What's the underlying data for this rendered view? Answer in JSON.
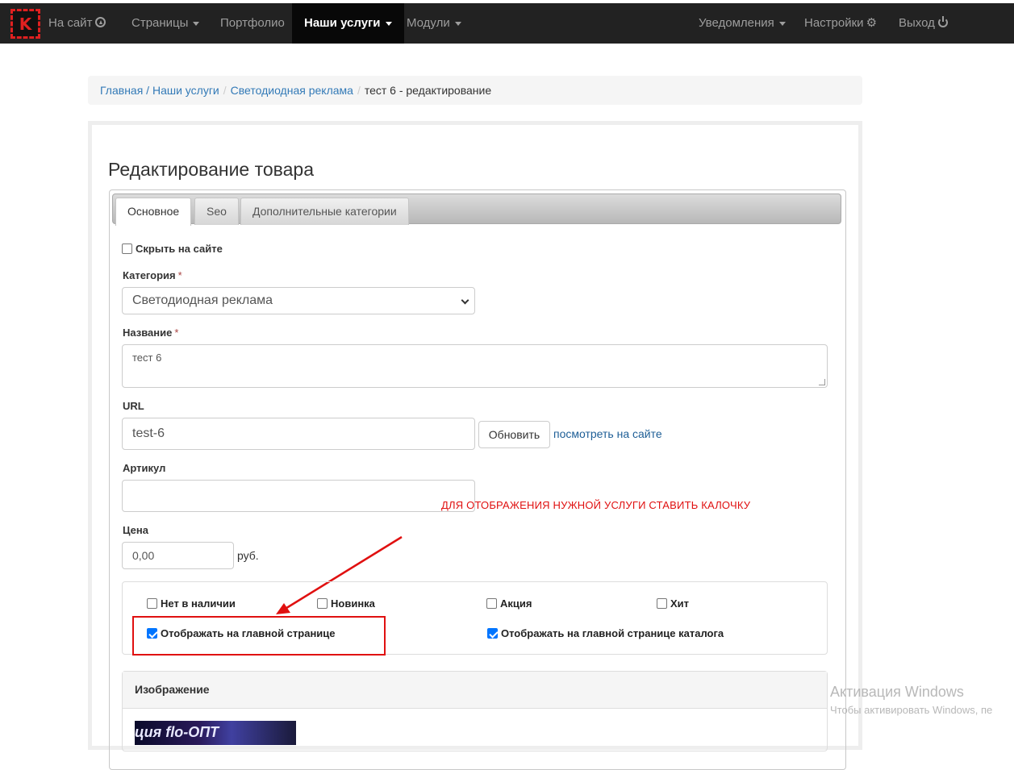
{
  "navbar": {
    "logo_letter": "K",
    "site_link": "На сайт",
    "pages": "Страницы",
    "portfolio": "Портфолио",
    "services": "Наши услуги",
    "modules": "Модули",
    "notifications": "Уведомления",
    "settings": "Настройки",
    "logout": "Выход"
  },
  "breadcrumb": {
    "home": "Главная",
    "services": "Наши услуги",
    "category": "Светодиодная реклама",
    "current": "тест 6 - редактирование"
  },
  "page_title": "Редактирование товара",
  "tabs": [
    "Основное",
    "Seo",
    "Дополнительные категории"
  ],
  "form": {
    "hide_on_site_label": "Скрыть на сайте",
    "hide_on_site": false,
    "category_label": "Категория",
    "category_value": "Светодиодная реклама",
    "name_label": "Название",
    "name_value": "тест 6",
    "required_mark": "*",
    "url_label": "URL",
    "url_value": "test-6",
    "refresh_button": "Обновить",
    "view_on_site": "посмотреть на сайте",
    "article_label": "Артикул",
    "article_value": "",
    "price_label": "Цена",
    "price_value": "0,00",
    "currency": "руб."
  },
  "annotation": "ДЛЯ ОТОБРАЖЕНИЯ НУЖНОЙ УСЛУГИ СТАВИТЬ КАЛОЧКУ",
  "options": [
    {
      "label": "Нет в наличии",
      "checked": false
    },
    {
      "label": "Новинка",
      "checked": false
    },
    {
      "label": "Акция",
      "checked": false
    },
    {
      "label": "Хит",
      "checked": false
    },
    {
      "label": "Отображать на главной странице",
      "checked": true
    },
    {
      "label": "Отображать на главной странице каталога",
      "checked": true
    }
  ],
  "image_panel": {
    "title": "Изображение",
    "thumb_text": "ция  flo-ОПТ"
  },
  "watermark": {
    "line1": "Активация Windows",
    "line2": "Чтобы активировать Windows, пе"
  },
  "colors": {
    "navbar_bg": "#222222",
    "link": "#337ab7",
    "annotation": "#e01010",
    "checkbox_checked": "#0075ff"
  }
}
